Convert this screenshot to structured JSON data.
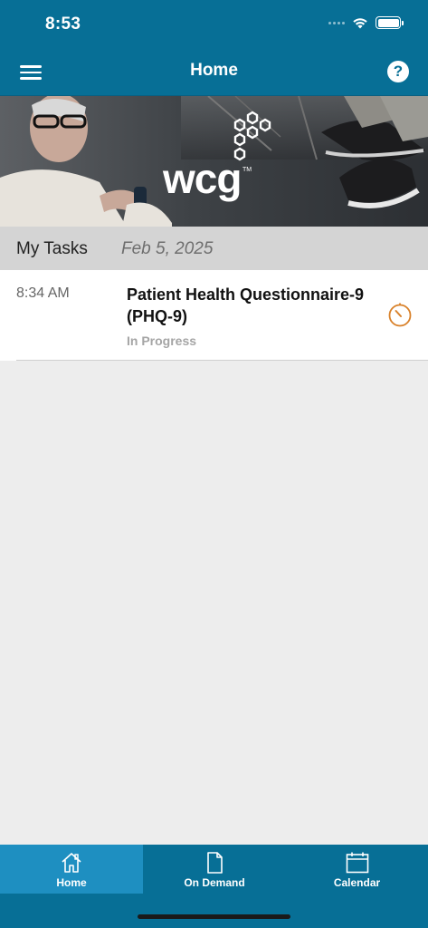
{
  "status_bar": {
    "time": "8:53"
  },
  "nav": {
    "title": "Home",
    "menu_icon": "hamburger-menu-icon",
    "help_icon": "help-question-icon",
    "help_glyph": "?"
  },
  "banner": {
    "logo_text": "wcg",
    "trademark": "TM"
  },
  "tasks": {
    "title": "My Tasks",
    "date": "Feb 5, 2025",
    "items": [
      {
        "time": "8:34 AM",
        "title": "Patient Health Questionnaire-9 (PHQ-9)",
        "status": "In Progress",
        "icon": "timer-icon",
        "icon_color": "#d9822b"
      }
    ]
  },
  "tab_bar": {
    "tabs": [
      {
        "label": "Home",
        "icon": "home-icon",
        "active": true
      },
      {
        "label": "On Demand",
        "icon": "document-icon",
        "active": false
      },
      {
        "label": "Calendar",
        "icon": "calendar-icon",
        "active": false
      }
    ]
  },
  "colors": {
    "brand": "#076f96",
    "active_tab": "#1e8fc1",
    "accent": "#d9822b"
  }
}
